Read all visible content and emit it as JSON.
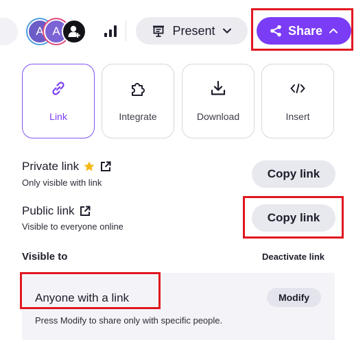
{
  "toolbar": {
    "avatars": [
      {
        "initial": "A",
        "color": "#6b5cc7"
      },
      {
        "initial": "A",
        "color": "#7b63d6"
      },
      {
        "icon": "add-user-icon",
        "color": "#121218"
      }
    ],
    "present_label": "Present",
    "share_label": "Share",
    "accent_color": "#7a3cf5"
  },
  "cards": [
    {
      "label": "Link",
      "icon": "link-icon",
      "active": true
    },
    {
      "label": "Integrate",
      "icon": "puzzle-icon",
      "active": false
    },
    {
      "label": "Download",
      "icon": "download-icon",
      "active": false
    },
    {
      "label": "Insert",
      "icon": "code-icon",
      "active": false
    }
  ],
  "private_link": {
    "title": "Private link",
    "subtitle": "Only visible with link",
    "copy_label": "Copy link"
  },
  "public_link": {
    "title": "Public link",
    "subtitle": "Visible to everyone online",
    "copy_label": "Copy link"
  },
  "visibility": {
    "heading": "Visible to",
    "deactivate_label": "Deactivate link",
    "audience": "Anyone with a link",
    "modify_label": "Modify",
    "hint": "Press Modify to share only with specific people."
  },
  "highlight_color": "#e0161f"
}
